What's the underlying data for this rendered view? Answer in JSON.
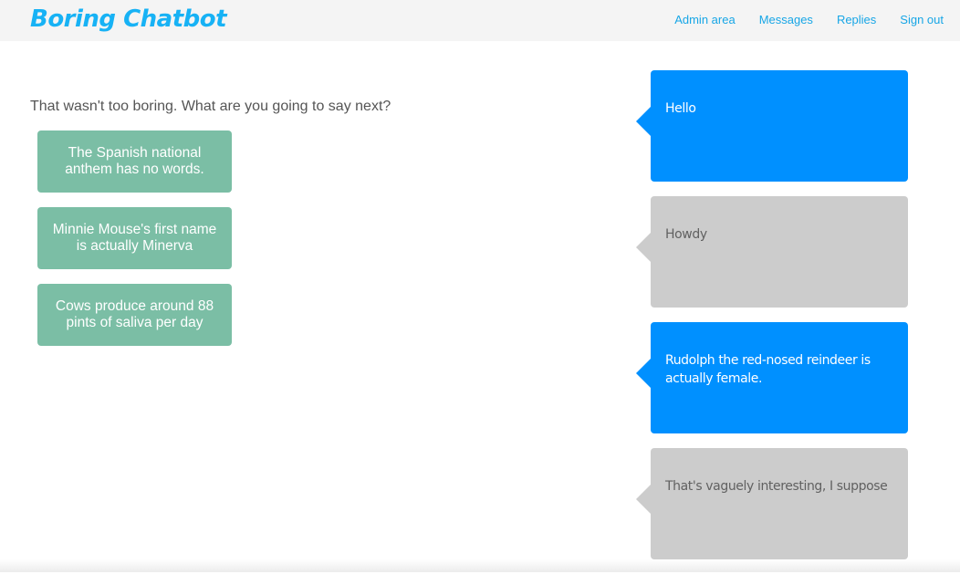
{
  "navbar": {
    "brand": "Boring Chatbot",
    "links": [
      {
        "label": "Admin area"
      },
      {
        "label": "Messages"
      },
      {
        "label": "Replies"
      },
      {
        "label": "Sign out"
      }
    ]
  },
  "main": {
    "prompt": "That wasn't too boring. What are you going to say next?",
    "reply_options": [
      {
        "label": "The Spanish national anthem has no words."
      },
      {
        "label": "Minnie Mouse's first name is actually Minerva"
      },
      {
        "label": "Cows produce around 88 pints of saliva per day"
      }
    ]
  },
  "chat": {
    "messages": [
      {
        "sender": "bot",
        "text": "Hello"
      },
      {
        "sender": "user",
        "text": "Howdy"
      },
      {
        "sender": "bot",
        "text": "Rudolph the red-nosed reindeer is actually female."
      },
      {
        "sender": "user",
        "text": "That's vaguely interesting, I suppose"
      }
    ]
  },
  "colors": {
    "brand": "#17b2f5",
    "nav_link": "#17a6e6",
    "reply_button": "#7bbea5",
    "bot_bubble": "#0090ff",
    "user_bubble": "#cccccc"
  }
}
